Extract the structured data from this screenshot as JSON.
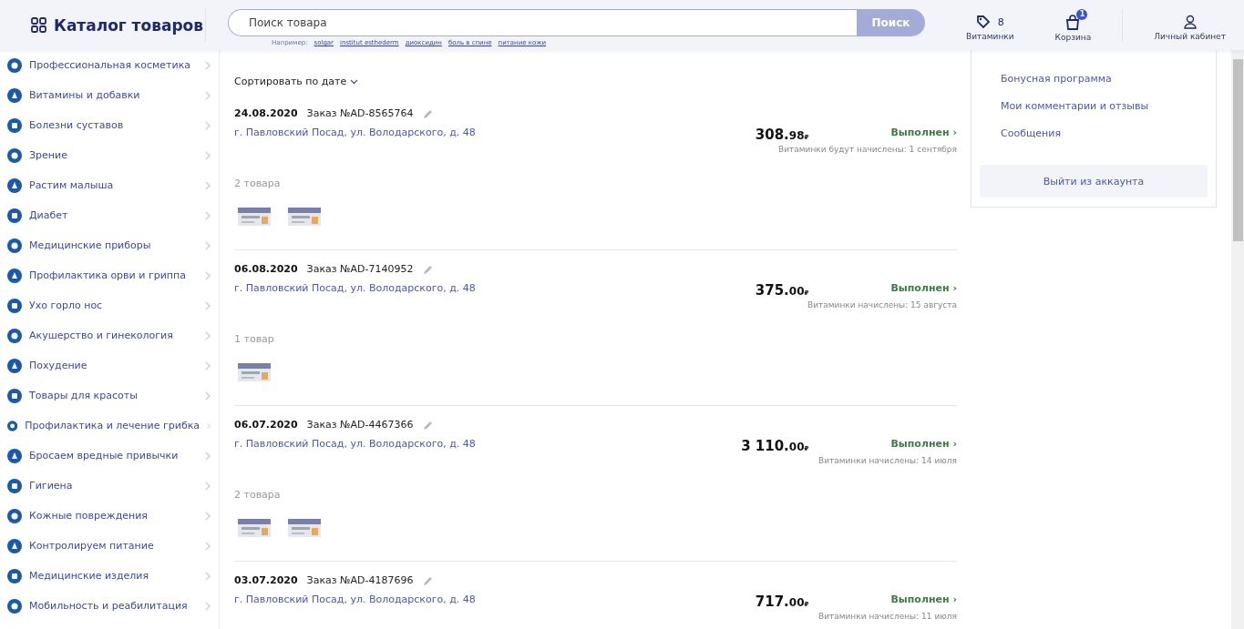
{
  "header": {
    "catalog_title": "Каталог товаров",
    "search": {
      "placeholder": "Поиск товара",
      "button": "Поиск",
      "examples_label": "Например:",
      "examples": [
        "solgar",
        "institut esthederm",
        "диоксидин",
        "боль в спине",
        "питание кожи"
      ]
    },
    "vitamins": {
      "count": "8",
      "label": "Витаминки"
    },
    "cart": {
      "badge": "1",
      "label": "Корзина"
    },
    "account": {
      "label": "Личный кабинет"
    }
  },
  "sidebar": {
    "items": [
      {
        "label": "Профессиональная косметика"
      },
      {
        "label": "Витамины и добавки"
      },
      {
        "label": "Болезни суставов"
      },
      {
        "label": "Зрение"
      },
      {
        "label": "Растим малыша"
      },
      {
        "label": "Диабет"
      },
      {
        "label": "Медицинские приборы"
      },
      {
        "label": "Профилактика орви и гриппа"
      },
      {
        "label": "Ухо горло нос"
      },
      {
        "label": "Акушерство и гинекология"
      },
      {
        "label": "Похудение"
      },
      {
        "label": "Товары для красоты"
      },
      {
        "label": "Профилактика и лечение грибка"
      },
      {
        "label": "Бросаем вредные привычки"
      },
      {
        "label": "Гигиена"
      },
      {
        "label": "Кожные повреждения"
      },
      {
        "label": "Контролируем питание"
      },
      {
        "label": "Медицинские изделия"
      },
      {
        "label": "Мобильность и реабилитация"
      }
    ]
  },
  "orders": {
    "sort_label": "Сортировать по дате",
    "items": [
      {
        "date": "24.08.2020",
        "number": "Заказ №AD-8565764",
        "address": "г. Павловский Посад, ул. Володарского, д. 48",
        "price": "308.",
        "cents": "98",
        "currency": "₽",
        "status": "Выполнен",
        "status_arrow": "›",
        "vitamins_note": "Витаминки будут начислены: 1 сентября",
        "count": "2 товара"
      },
      {
        "date": "06.08.2020",
        "number": "Заказ №AD-7140952",
        "address": "г. Павловский Посад, ул. Володарского, д. 48",
        "price": "375.",
        "cents": "00",
        "currency": "₽",
        "status": "Выполнен",
        "status_arrow": "›",
        "vitamins_note": "Витаминки начислены: 15 августа",
        "count": "1 товар"
      },
      {
        "date": "06.07.2020",
        "number": "Заказ №AD-4467366",
        "address": "г. Павловский Посад, ул. Володарского, д. 48",
        "price": "3 110.",
        "cents": "00",
        "currency": "₽",
        "status": "Выполнен",
        "status_arrow": "›",
        "vitamins_note": "Витаминки начислены: 14 июля",
        "count": "2 товара"
      },
      {
        "date": "03.07.2020",
        "number": "Заказ №AD-4187696",
        "address": "г. Павловский Посад, ул. Володарского, д. 48",
        "price": "717.",
        "cents": "00",
        "currency": "₽",
        "status": "Выполнен",
        "status_arrow": "›",
        "vitamins_note": "Витаминки начислены: 11 июля"
      }
    ]
  },
  "account_menu": {
    "links": [
      "Бонусная программа",
      "Мои комментарии и отзывы",
      "Сообщения"
    ],
    "logout": "Выйти из аккаунта"
  }
}
